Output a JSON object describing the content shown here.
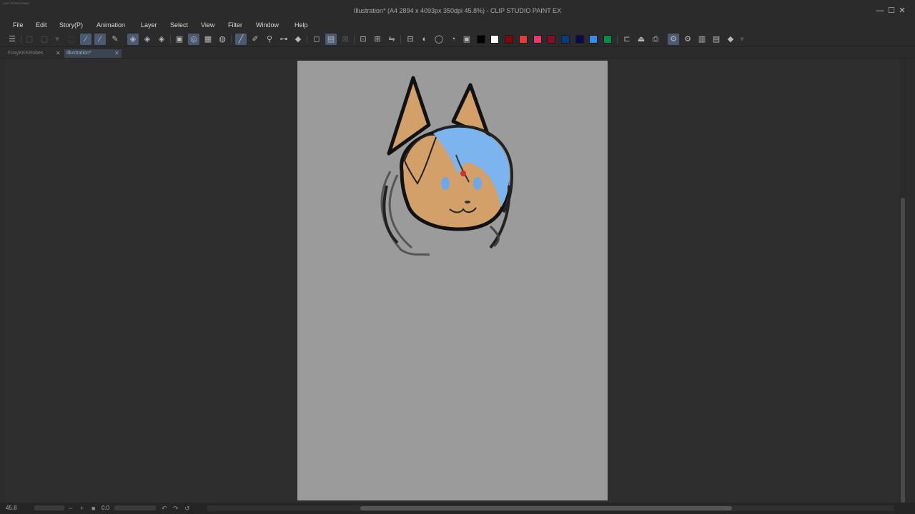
{
  "window": {
    "app_icon_text": "CLIP STUDIO PAINT",
    "title": "Illustration* (A4 2894 x 4093px 350dpi 45.8%) - CLIP STUDIO PAINT EX",
    "controls": {
      "minimize": "—",
      "maximize": "☐",
      "close": "✕"
    }
  },
  "menu": [
    "File",
    "Edit",
    "Story(P)",
    "Animation",
    "Layer",
    "Select",
    "View",
    "Filter",
    "Window",
    "Help"
  ],
  "toolbar": {
    "menu_icon": "hamburger-icon",
    "palette_colors": [
      "#000000",
      "#ffffff",
      "#7a0a0a",
      "#e83a3a",
      "#e83a6a",
      "#8a0a2a",
      "#0a3a7a",
      "#0a0a4a",
      "#3a8ae8",
      "#0a8a4a"
    ]
  },
  "tabs": [
    {
      "label": "FoxyKKKRobes",
      "active": false
    },
    {
      "label": "Illustration*",
      "active": true
    }
  ],
  "tab_close_glyph": "✕",
  "canvas": {
    "background": "#9b9b9b"
  },
  "status": {
    "zoom": "45.8",
    "zoom_minus": "−",
    "zoom_plus": "+",
    "rotation": "0.0"
  }
}
